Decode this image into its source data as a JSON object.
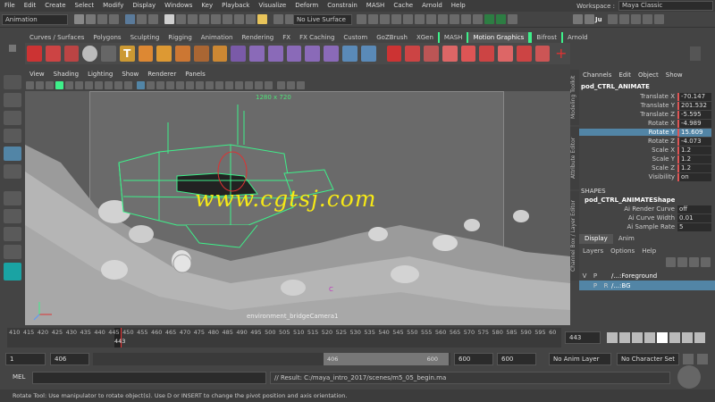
{
  "menubar": {
    "items": [
      "File",
      "Edit",
      "Create",
      "Select",
      "Modify",
      "Display",
      "Windows",
      "Key",
      "Playback",
      "Visualize",
      "Deform",
      "Constrain",
      "MASH",
      "Cache",
      "Arnold",
      "Help"
    ],
    "workspace_label": "Workspace :",
    "workspace_value": "Maya Classic"
  },
  "statusline": {
    "mode": "Animation",
    "live_surface": "No Live Surface",
    "user": "Ju"
  },
  "shelf": {
    "tabs": [
      "Curves / Surfaces",
      "Polygons",
      "Sculpting",
      "Rigging",
      "Animation",
      "Rendering",
      "FX",
      "FX Caching",
      "Custom",
      "GoZBrush",
      "XGen",
      "MASH",
      "Motion Graphics",
      "Bifrost",
      "Arnold"
    ],
    "active_tab": "Motion Graphics"
  },
  "panel": {
    "menu": [
      "View",
      "Shading",
      "Lighting",
      "Show",
      "Renderer",
      "Panels"
    ],
    "resolution": "1280 x 720",
    "camera": "environment_bridgeCamera1",
    "marker": "C",
    "watermark": "www.cgtsj.com"
  },
  "channelbox": {
    "menu": [
      "Channels",
      "Edit",
      "Object",
      "Show"
    ],
    "object": "pod_CTRL_ANIMATE",
    "attributes": [
      {
        "label": "Translate X",
        "value": "-70.147"
      },
      {
        "label": "Translate Y",
        "value": "201.532"
      },
      {
        "label": "Translate Z",
        "value": "-5.595"
      },
      {
        "label": "Rotate X",
        "value": "-4.989"
      },
      {
        "label": "Rotate Y",
        "value": "15.609"
      },
      {
        "label": "Rotate Z",
        "value": "-4.073"
      },
      {
        "label": "Scale X",
        "value": "1.2"
      },
      {
        "label": "Scale Y",
        "value": "1.2"
      },
      {
        "label": "Scale Z",
        "value": "1.2"
      },
      {
        "label": "Visibility",
        "value": "on"
      }
    ],
    "shapes_header": "SHAPES",
    "shape_name": "pod_CTRL_ANIMATEShape",
    "shape_attrs": [
      {
        "label": "Ai Render Curve",
        "value": "off"
      },
      {
        "label": "Ai Curve Width",
        "value": "0.01"
      },
      {
        "label": "Ai Sample Rate",
        "value": "5"
      }
    ],
    "side_tabs": [
      "Modeling Toolkit",
      "Attribute Editor",
      "Channel Box / Layer Editor"
    ]
  },
  "layers": {
    "tabs": [
      "Display",
      "Anim"
    ],
    "menu": [
      "Layers",
      "Options",
      "Help"
    ],
    "header": [
      "V",
      "P",
      "",
      "/...Foreground"
    ],
    "rows": [
      {
        "v": "V",
        "p": "P",
        "r": "",
        "name": "/...:Foreground"
      },
      {
        "v": "",
        "p": "P",
        "r": "R",
        "name": "/...:BG"
      }
    ]
  },
  "timeline": {
    "ticks": [
      "410",
      "415",
      "420",
      "425",
      "430",
      "435",
      "440",
      "445",
      "450",
      "455",
      "460",
      "465",
      "470",
      "475",
      "480",
      "485",
      "490",
      "495",
      "500",
      "505",
      "510",
      "515",
      "520",
      "525",
      "530",
      "535",
      "540",
      "545",
      "550",
      "555",
      "560",
      "565",
      "570",
      "575",
      "580",
      "585",
      "590",
      "595",
      "60"
    ],
    "current_frame_label": "443",
    "current_frame_field": "443"
  },
  "range": {
    "start": "1",
    "range_start": "406",
    "slider_start": "406",
    "slider_end": "600",
    "range_end": "600",
    "end": "600",
    "anim_layer": "No Anim Layer",
    "char_set": "No Character Set"
  },
  "mel": {
    "label": "MEL",
    "result": "// Result: C:/maya_intro_2017/scenes/m5_05_begin.ma"
  },
  "helpline": "Rotate Tool: Use manipulator to rotate object(s). Use D or INSERT to change the pivot position and axis orientation.",
  "colors": {
    "highlight": "#5285a6",
    "keyed": "#d55555",
    "wireframe": "#3ef08a",
    "watermark": "#f6e816"
  }
}
